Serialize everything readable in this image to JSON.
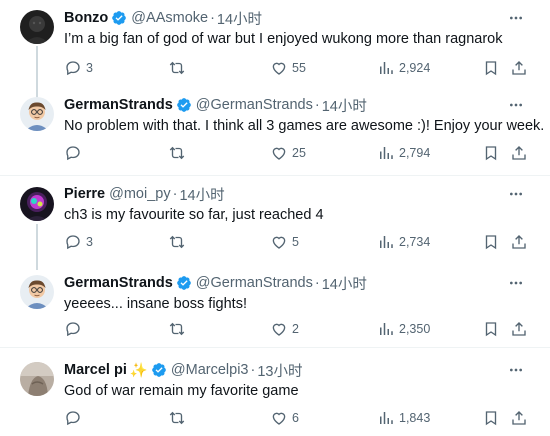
{
  "tweets": [
    {
      "name": "Bonzo",
      "verified": true,
      "handle": "@AAsmoke",
      "time": "14小时",
      "text": "I’m a big fan of god of war but I enjoyed wukong more than ragnarok",
      "stats": {
        "replies": "3",
        "retweets": "",
        "likes": "55",
        "views": "2,924"
      }
    },
    {
      "name": "GermanStrands",
      "verified": true,
      "handle": "@GermanStrands",
      "time": "14小时",
      "text": "No problem with that. I think all 3 games are awesome :)! Enjoy your week.",
      "stats": {
        "replies": "",
        "retweets": "",
        "likes": "25",
        "views": "2,794"
      }
    },
    {
      "name": "Pierre",
      "verified": false,
      "handle": "@moi_py",
      "time": "14小时",
      "text": "ch3 is my favourite so far, just reached 4",
      "stats": {
        "replies": "3",
        "retweets": "",
        "likes": "5",
        "views": "2,734"
      }
    },
    {
      "name": "GermanStrands",
      "verified": true,
      "handle": "@GermanStrands",
      "time": "14小时",
      "text": "yeeees... insane boss fights!",
      "stats": {
        "replies": "",
        "retweets": "",
        "likes": "2",
        "views": "2,350"
      }
    },
    {
      "name": "Marcel pi",
      "name_emoji": "✨",
      "verified": true,
      "handle": "@Marcelpi3",
      "time": "13小时",
      "text": "God of war remain my favorite game",
      "stats": {
        "replies": "",
        "retweets": "",
        "likes": "6",
        "views": "1,843"
      }
    }
  ],
  "separator": "·",
  "icons": {
    "verified": "verified-badge-icon",
    "more": "more-icon",
    "reply": "reply-icon",
    "retweet": "retweet-icon",
    "like": "heart-icon",
    "views": "views-icon",
    "bookmark": "bookmark-icon",
    "share": "share-icon"
  },
  "colors": {
    "verified": "#1d9bf0",
    "muted": "#536471",
    "text": "#0f1419",
    "line": "#cfd9de",
    "emoji": "#ffd23c"
  }
}
